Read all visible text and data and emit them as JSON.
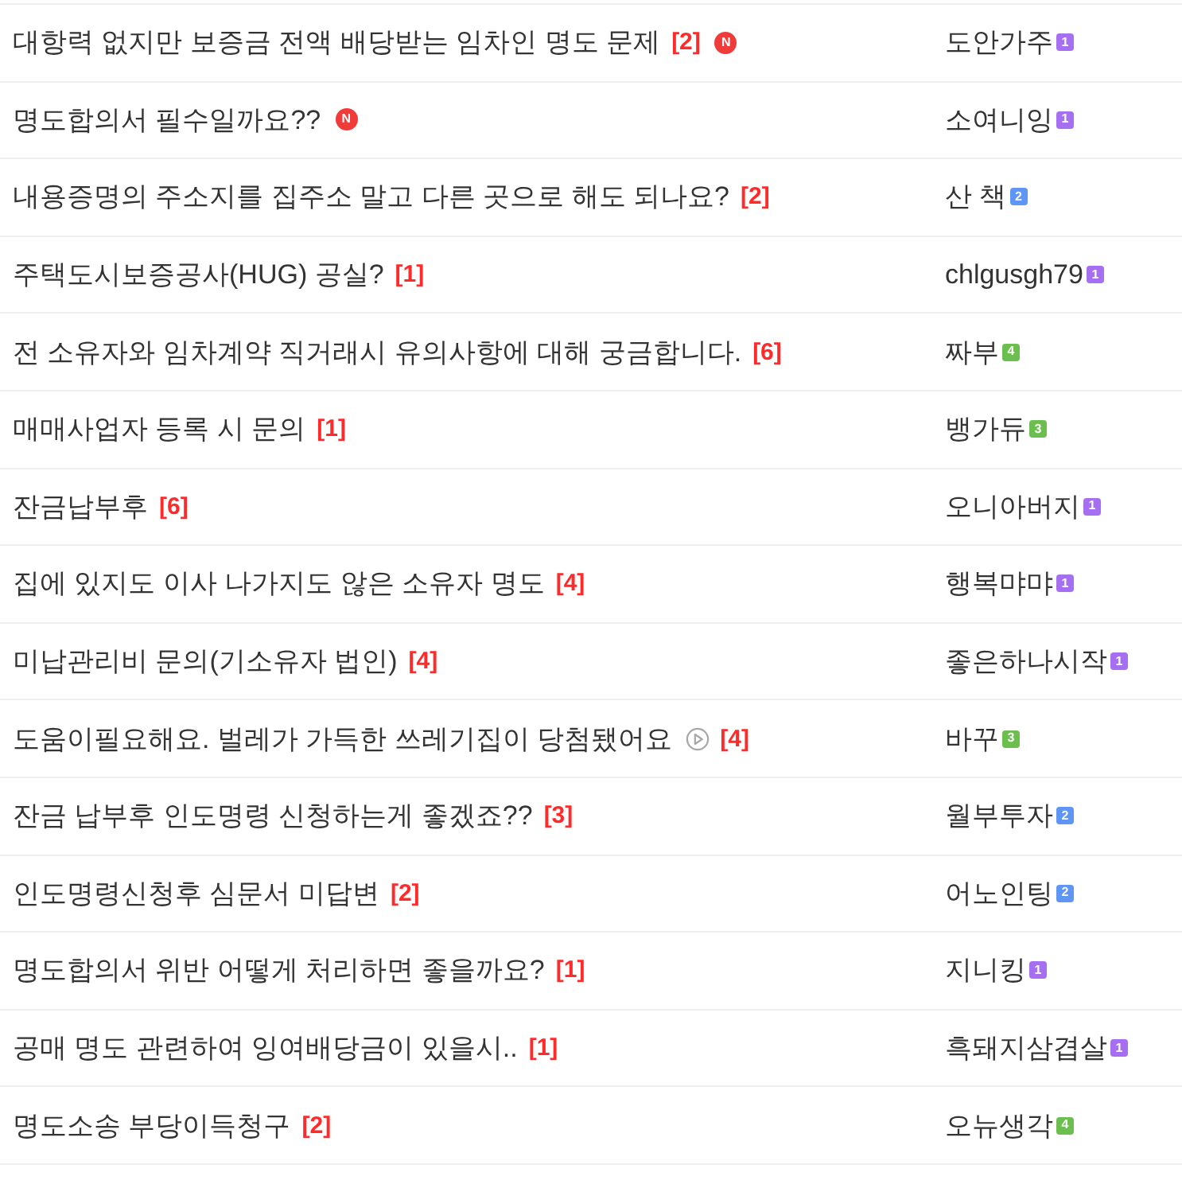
{
  "posts": [
    {
      "title": "대항력 없지만 보증금 전액 배당받는 임차인 명도 문제",
      "comments": "[2]",
      "new_badge": "N",
      "author": "도안가주",
      "level": {
        "text": "1",
        "color": "#a66ef0"
      }
    },
    {
      "title": "명도합의서 필수일까요??",
      "new_badge": "N",
      "author": "소여니잉",
      "level": {
        "text": "1",
        "color": "#a66ef0"
      }
    },
    {
      "title": "내용증명의 주소지를 집주소 말고 다른 곳으로 해도 되나요?",
      "comments": "[2]",
      "author": "산 책",
      "level": {
        "text": "2",
        "color": "#5f95f5"
      }
    },
    {
      "title": "주택도시보증공사(HUG) 공실?",
      "comments": "[1]",
      "author": "chlgusgh79",
      "level": {
        "text": "1",
        "color": "#a66ef0"
      }
    },
    {
      "title": "전 소유자와 임차계약 직거래시 유의사항에 대해 궁금합니다.",
      "comments": "[6]",
      "author": "짜부",
      "level": {
        "text": "4",
        "color": "#6cbf4f"
      }
    },
    {
      "title": "매매사업자 등록 시 문의",
      "comments": "[1]",
      "author": "뱅가듀",
      "level": {
        "text": "3",
        "color": "#6cbf4f"
      }
    },
    {
      "title": "잔금납부후",
      "comments": "[6]",
      "author": "오니아버지",
      "level": {
        "text": "1",
        "color": "#a66ef0"
      }
    },
    {
      "title": "집에 있지도 이사 나가지도 않은 소유자 명도",
      "comments": "[4]",
      "author": "행복먀먀",
      "level": {
        "text": "1",
        "color": "#a66ef0"
      }
    },
    {
      "title": "미납관리비 문의(기소유자 법인)",
      "comments": "[4]",
      "author": "좋은하나시작",
      "level": {
        "text": "1",
        "color": "#a66ef0"
      }
    },
    {
      "title": "도움이필요해요. 벌레가 가득한 쓰레기집이 당첨됐어요",
      "video": true,
      "comments": "[4]",
      "author": "바꾸",
      "level": {
        "text": "3",
        "color": "#6cbf4f"
      }
    },
    {
      "title": "잔금 납부후 인도명령 신청하는게 좋겠죠??",
      "comments": "[3]",
      "author": "월부투자",
      "level": {
        "text": "2",
        "color": "#5f95f5"
      }
    },
    {
      "title": "인도명령신청후 심문서 미답변",
      "comments": "[2]",
      "author": "어노인팅",
      "level": {
        "text": "2",
        "color": "#5f95f5"
      }
    },
    {
      "title": "명도합의서 위반 어떻게 처리하면 좋을까요?",
      "comments": "[1]",
      "author": "지니킹",
      "level": {
        "text": "1",
        "color": "#a66ef0"
      }
    },
    {
      "title": "공매 명도 관련하여 잉여배당금이 있을시..",
      "comments": "[1]",
      "author": "흑돼지삼겹살",
      "level": {
        "text": "1",
        "color": "#a66ef0"
      }
    },
    {
      "title": "명도소송 부당이득청구",
      "comments": "[2]",
      "author": "오뉴생각",
      "level": {
        "text": "4",
        "color": "#6cbf4f"
      }
    }
  ]
}
